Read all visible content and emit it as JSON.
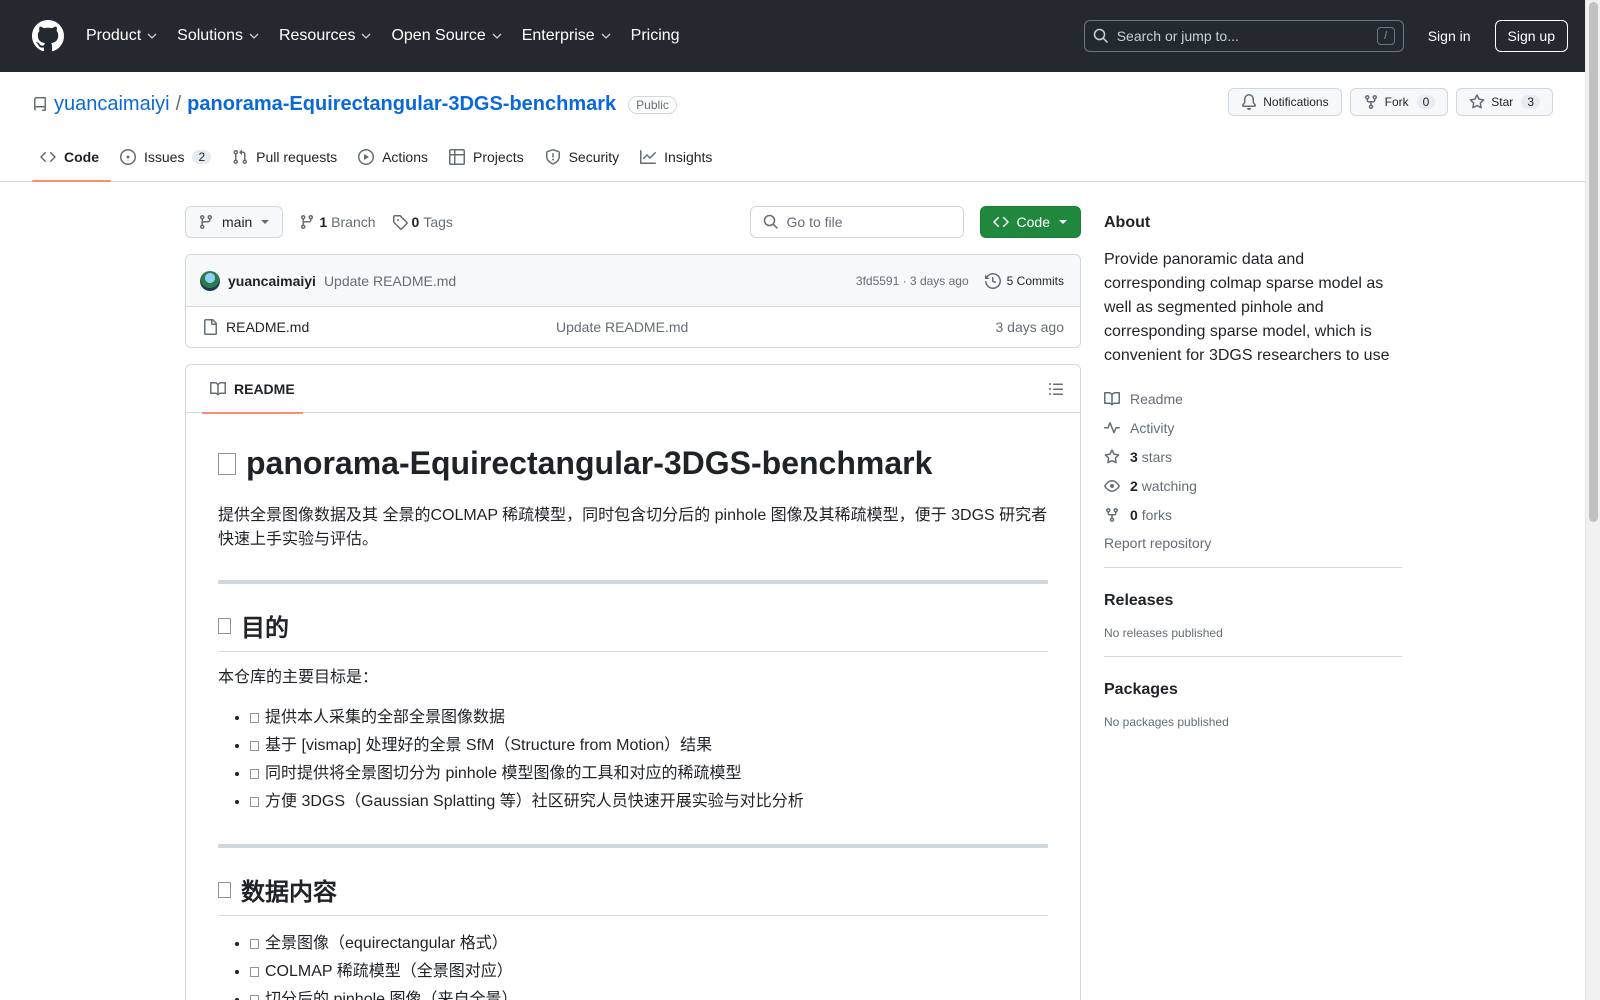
{
  "header": {
    "nav": [
      "Product",
      "Solutions",
      "Resources",
      "Open Source",
      "Enterprise",
      "Pricing"
    ],
    "search_placeholder": "Search or jump to...",
    "search_shortcut": "/",
    "sign_in": "Sign in",
    "sign_up": "Sign up"
  },
  "repo": {
    "owner": "yuancaimaiyi",
    "separator": "/",
    "name": "panorama-Equirectangular-3DGS-benchmark",
    "visibility": "Public",
    "notifications_label": "Notifications",
    "fork_label": "Fork",
    "fork_count": "0",
    "star_label": "Star",
    "star_count": "3"
  },
  "tabs": [
    {
      "label": "Code",
      "count": null
    },
    {
      "label": "Issues",
      "count": "2"
    },
    {
      "label": "Pull requests",
      "count": null
    },
    {
      "label": "Actions",
      "count": null
    },
    {
      "label": "Projects",
      "count": null
    },
    {
      "label": "Security",
      "count": null
    },
    {
      "label": "Insights",
      "count": null
    }
  ],
  "toolbar": {
    "branch": "main",
    "branch_count": "1",
    "branch_label": "Branch",
    "tag_count": "0",
    "tag_label": "Tags",
    "goto_placeholder": "Go to file",
    "code_label": "Code"
  },
  "latest_commit": {
    "author": "yuancaimaiyi",
    "message": "Update README.md",
    "meta": "3fd5591 · 3 days ago",
    "commits": "5 Commits"
  },
  "files": [
    {
      "name": "README.md",
      "message": "Update README.md",
      "date": "3 days ago"
    }
  ],
  "readme": {
    "tab_label": "README",
    "title": "panorama-Equirectangular-3DGS-benchmark",
    "intro": "提供全景图像数据及其 全景的COLMAP 稀疏模型，同时包含切分后的 pinhole 图像及其稀疏模型，便于 3DGS 研究者快速上手实验与评估。",
    "section1_title": "目的",
    "section1_lead": "本仓库的主要目标是：",
    "section1_items": [
      "提供本人采集的全部全景图像数据",
      "基于 [vismap] 处理好的全景 SfM（Structure from Motion）结果",
      "同时提供将全景图切分为 pinhole 模型图像的工具和对应的稀疏模型",
      "方便 3DGS（Gaussian Splatting 等）社区研究人员快速开展实验与对比分析"
    ],
    "section2_title": "数据内容",
    "section2_items": [
      "全景图像（equirectangular 格式）",
      "COLMAP 稀疏模型（全景图对应）",
      "切分后的 pinhole 图像（来自全景）"
    ]
  },
  "sidebar": {
    "about_title": "About",
    "about_text": "Provide panoramic data and corresponding colmap sparse model as well as segmented pinhole and corresponding sparse model, which is convenient for 3DGS researchers to use",
    "readme": "Readme",
    "activity": "Activity",
    "stars_count": "3",
    "stars_label": "stars",
    "watching_count": "2",
    "watching_label": "watching",
    "forks_count": "0",
    "forks_label": "forks",
    "report": "Report repository",
    "releases_title": "Releases",
    "releases_text": "No releases published",
    "packages_title": "Packages",
    "packages_text": "No packages published"
  },
  "colors": {
    "header_bg": "#24292f",
    "link": "#0969da",
    "code_button": "#1f883d",
    "tab_underline": "#fd8c73"
  }
}
